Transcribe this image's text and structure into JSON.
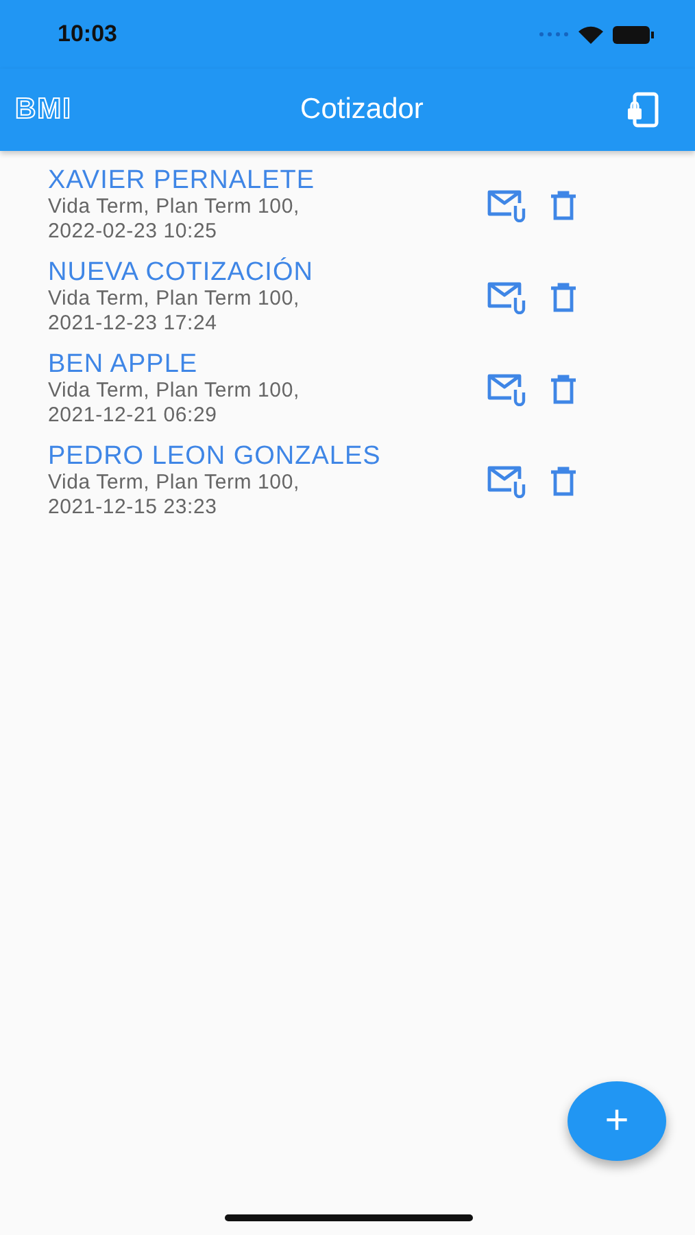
{
  "status_bar": {
    "time": "10:03"
  },
  "app_bar": {
    "logo": "BMI",
    "title": "Cotizador"
  },
  "quotes": [
    {
      "name": "XAVIER PERNALETE",
      "detail": "Vida Term, Plan Term 100,",
      "date": "2022-02-23 10:25"
    },
    {
      "name": "NUEVA COTIZACIÓN",
      "detail": "Vida Term, Plan Term 100,",
      "date": "2021-12-23 17:24"
    },
    {
      "name": "BEN APPLE",
      "detail": "Vida Term, Plan Term 100,",
      "date": "2021-12-21 06:29"
    },
    {
      "name": "PEDRO LEON GONZALES",
      "detail": "Vida Term, Plan Term 100,",
      "date": "2021-12-15 23:23"
    }
  ],
  "fab": {
    "label": "+"
  }
}
